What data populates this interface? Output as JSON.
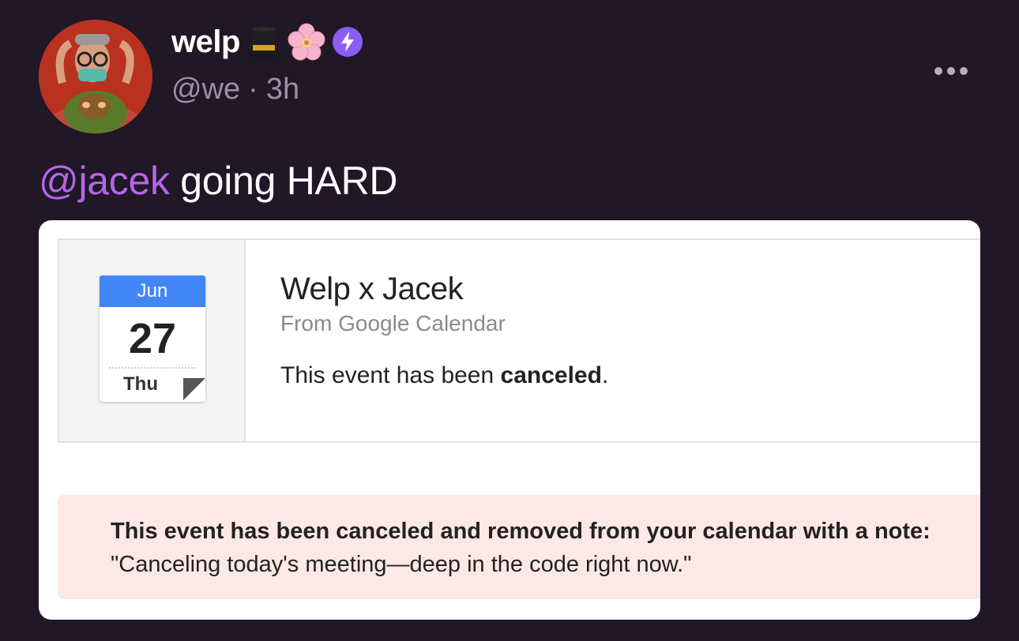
{
  "post": {
    "display_name": "welp",
    "handle": "@we",
    "separator": "·",
    "time": "3h",
    "mention": "@jacek",
    "text": " going HARD",
    "emojis": [
      "top-hat-emoji",
      "cherry-blossom-emoji"
    ],
    "badge": "lightning-badge-icon",
    "accent_color": "#b566e8",
    "background_color": "#201727"
  },
  "calendar_invite": {
    "month": "Jun",
    "day": "27",
    "weekday": "Thu",
    "title": "Welp x Jacek",
    "source": "From Google Calendar",
    "status_prefix": "This event has been ",
    "status_bold": "canceled",
    "status_suffix": ".",
    "note_heading": "This event has been canceled and removed from your calendar with a note:",
    "note_text": "\"Canceling today's meeting—deep in the code right now.\"",
    "month_color": "#4285f4",
    "note_background": "#fce8e6"
  }
}
